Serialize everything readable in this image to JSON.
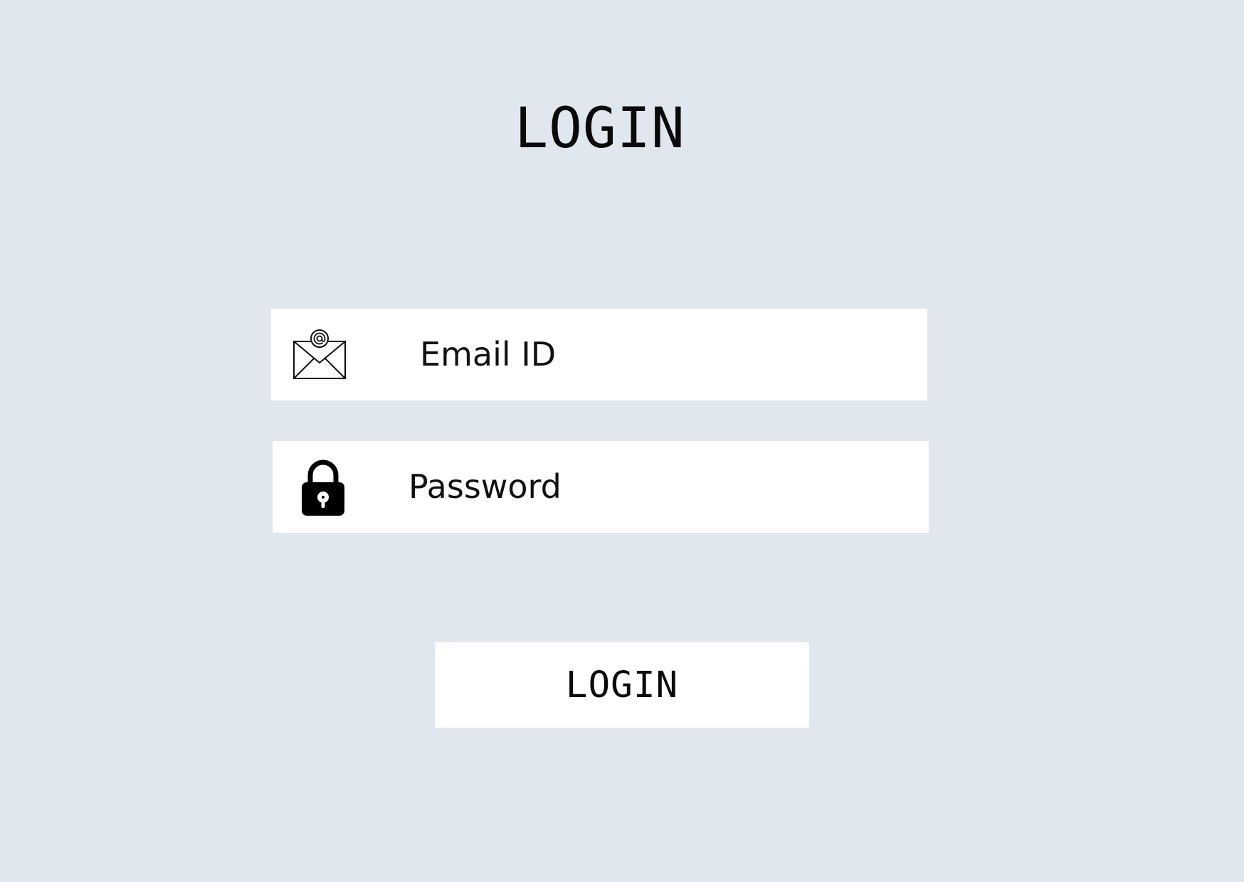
{
  "page": {
    "title": "LOGIN",
    "background_color": "#e0e7ee"
  },
  "form": {
    "email": {
      "icon": "envelope-at-icon",
      "placeholder": "Email ID"
    },
    "password": {
      "icon": "padlock-icon",
      "placeholder": "Password"
    },
    "submit_label": "LOGIN"
  }
}
